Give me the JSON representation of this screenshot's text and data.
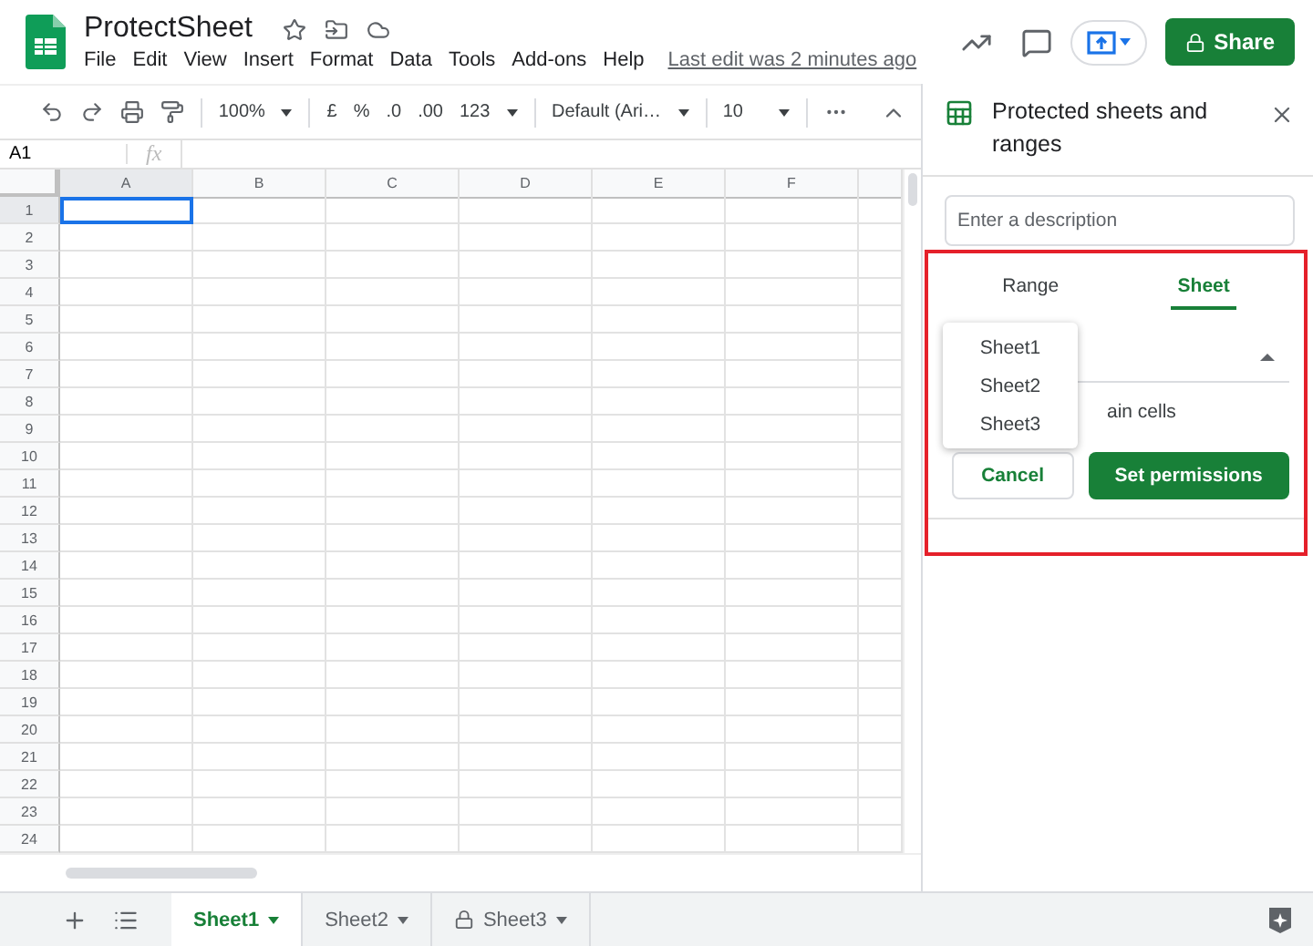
{
  "document": {
    "title": "ProtectSheet",
    "last_edit": "Last edit was 2 minutes ago"
  },
  "menu": [
    "File",
    "Edit",
    "View",
    "Insert",
    "Format",
    "Data",
    "Tools",
    "Add-ons",
    "Help"
  ],
  "share_button": "Share",
  "toolbar": {
    "zoom": "100%",
    "currency": "£",
    "percent": "%",
    "decrease_decimal": ".0",
    "increase_decimal": ".00",
    "number_format": "123",
    "font": "Default (Ari…",
    "font_size": "10"
  },
  "formula_bar": {
    "cell_reference": "A1",
    "formula_label": "fx"
  },
  "columns": [
    {
      "label": "A",
      "selected": true
    },
    {
      "label": "B",
      "selected": false
    },
    {
      "label": "C",
      "selected": false
    },
    {
      "label": "D",
      "selected": false
    },
    {
      "label": "E",
      "selected": false
    },
    {
      "label": "F",
      "selected": false
    }
  ],
  "rows": [
    {
      "label": "1",
      "selected": true
    },
    {
      "label": "2",
      "selected": false
    },
    {
      "label": "3",
      "selected": false
    },
    {
      "label": "4",
      "selected": false
    },
    {
      "label": "5",
      "selected": false
    },
    {
      "label": "6",
      "selected": false
    },
    {
      "label": "7",
      "selected": false
    },
    {
      "label": "8",
      "selected": false
    },
    {
      "label": "9",
      "selected": false
    },
    {
      "label": "10",
      "selected": false
    },
    {
      "label": "11",
      "selected": false
    },
    {
      "label": "12",
      "selected": false
    },
    {
      "label": "13",
      "selected": false
    },
    {
      "label": "14",
      "selected": false
    },
    {
      "label": "15",
      "selected": false
    },
    {
      "label": "16",
      "selected": false
    },
    {
      "label": "17",
      "selected": false
    },
    {
      "label": "18",
      "selected": false
    },
    {
      "label": "19",
      "selected": false
    },
    {
      "label": "20",
      "selected": false
    },
    {
      "label": "21",
      "selected": false
    },
    {
      "label": "22",
      "selected": false
    },
    {
      "label": "23",
      "selected": false
    },
    {
      "label": "24",
      "selected": false
    }
  ],
  "sheet_tabs": [
    {
      "label": "Sheet1",
      "selected": true,
      "locked": false
    },
    {
      "label": "Sheet2",
      "selected": false,
      "locked": false
    },
    {
      "label": "Sheet3",
      "selected": false,
      "locked": true
    }
  ],
  "panel": {
    "title": "Protected sheets and ranges",
    "description_placeholder": "Enter a description",
    "tabs": [
      {
        "label": "Range",
        "selected": false
      },
      {
        "label": "Sheet",
        "selected": true
      }
    ],
    "checkbox_label": "ain cells",
    "dropdown_options": [
      "Sheet1",
      "Sheet2",
      "Sheet3"
    ],
    "cancel_button": "Cancel",
    "confirm_button": "Set permissions"
  }
}
